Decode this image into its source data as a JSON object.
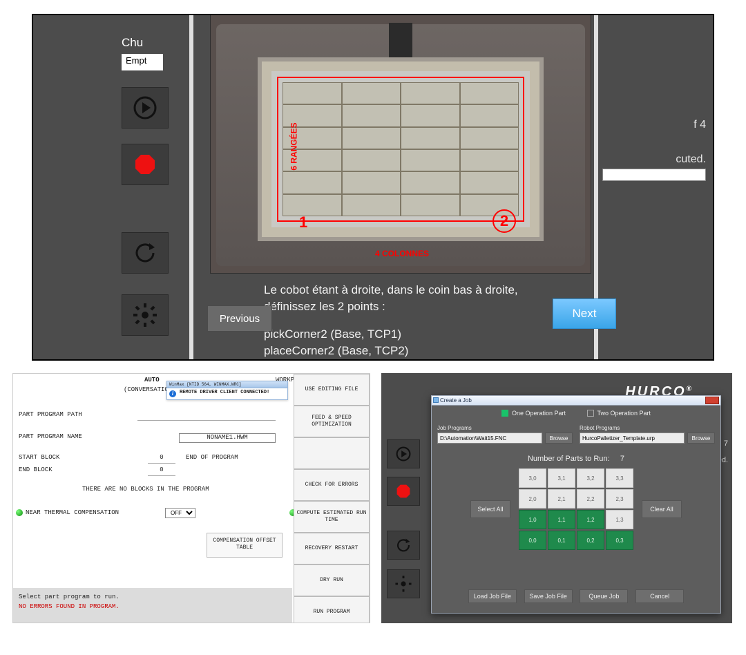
{
  "panel1": {
    "chu_label": "Chu",
    "input_value": "Empt",
    "status_of": "f    4",
    "status_exec": "cuted.",
    "instruction_line1": "Le cobot étant à droite, dans le coin bas à droite,",
    "instruction_line2": "définissez les 2 points :",
    "pick_line": "pickCorner2 (Base, TCP1)",
    "place_line": "placeCorner2 (Base, TCP2)",
    "prev_btn": "Previous",
    "next_btn": "Next",
    "annotation_rows": "6 RANGÉES",
    "annotation_cols": "4 COLONNES",
    "annotation_pt1": "1",
    "annotation_pt2": "2"
  },
  "panel2_left": {
    "hdr_auto": "AUTO",
    "hdr_conv": "(CONVERSATIONAL)",
    "hdr_trans": "WORKPC_TRANS",
    "notif_title": "WinMax [NTID 564, WINMAX.WRC]",
    "notif_msg": "REMOTE DRIVER CLIENT CONNECTED!",
    "lbl_path": "PART PROGRAM PATH",
    "lbl_name": "PART PROGRAM NAME",
    "name_value": "NONAME1.HWM",
    "lbl_start": "START BLOCK",
    "start_value": "0",
    "lbl_endprog": "END OF PROGRAM",
    "lbl_end": "END BLOCK",
    "end_value": "0",
    "no_blocks": "THERE ARE NO BLOCKS IN THE PROGRAM",
    "lbl_thermal": "NEAR THERMAL COMPENSATION",
    "thermal_value": "OFF",
    "comp_table": "COMPENSATION OFFSET TABLE",
    "msg1": "Select part program to run.",
    "msg2": "NO ERRORS FOUND IN PROGRAM.",
    "sidebtns": [
      "USE EDITING FILE",
      "FEED & SPEED OPTIMIZATION",
      "",
      "CHECK FOR ERRORS",
      "COMPUTE ESTIMATED RUN TIME",
      "RECOVERY RESTART",
      "DRY RUN",
      "RUN PROGRAM"
    ]
  },
  "panel2_right": {
    "brand": "HURCO",
    "rightmeta_num": "7",
    "rightmeta_exec": "ted.",
    "dialog": {
      "title": "Create a Job",
      "radio_one": "One Operation Part",
      "radio_two": "Two Operation Part",
      "job_prog_label": "Job Programs",
      "job_prog_value": "D:\\Automation\\Wait15.FNC",
      "robot_prog_label": "Robot Programs",
      "robot_prog_value": "HurcoPalletizer_Template.urp",
      "browse": "Browse",
      "num_parts_label": "Number of Parts to Run:",
      "num_parts_value": "7",
      "select_all": "Select All",
      "clear_all": "Clear All",
      "actions": [
        "Load Job File",
        "Save Job File",
        "Queue Job",
        "Cancel"
      ],
      "grid": [
        [
          {
            "v": "3,0",
            "sel": false
          },
          {
            "v": "3,1",
            "sel": false
          },
          {
            "v": "3,2",
            "sel": false
          },
          {
            "v": "3,3",
            "sel": false
          }
        ],
        [
          {
            "v": "2,0",
            "sel": false
          },
          {
            "v": "2,1",
            "sel": false
          },
          {
            "v": "2,2",
            "sel": false
          },
          {
            "v": "2,3",
            "sel": false
          }
        ],
        [
          {
            "v": "1,0",
            "sel": true
          },
          {
            "v": "1,1",
            "sel": true
          },
          {
            "v": "1,2",
            "sel": true
          },
          {
            "v": "1,3",
            "sel": false
          }
        ],
        [
          {
            "v": "0,0",
            "sel": true
          },
          {
            "v": "0,1",
            "sel": true
          },
          {
            "v": "0,2",
            "sel": true
          },
          {
            "v": "0,3",
            "sel": true
          }
        ]
      ]
    }
  }
}
